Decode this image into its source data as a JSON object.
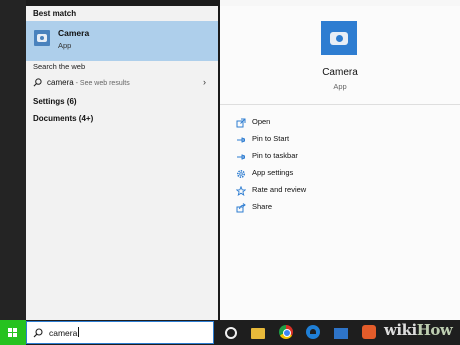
{
  "search_results": {
    "best_match_title": "Best match",
    "best_match": {
      "name": "Camera",
      "type": "App",
      "icon": "camera-icon"
    },
    "search_web_title": "Search the web",
    "web_result": {
      "query": "camera",
      "hint": " - See web results"
    },
    "settings_label": "Settings (6)",
    "documents_label": "Documents (4+)"
  },
  "detail": {
    "name": "Camera",
    "type": "App",
    "actions": [
      {
        "label": "Open",
        "icon": "open-icon"
      },
      {
        "label": "Pin to Start",
        "icon": "pin-icon"
      },
      {
        "label": "Pin to taskbar",
        "icon": "pin-icon"
      },
      {
        "label": "App settings",
        "icon": "gear-icon"
      },
      {
        "label": "Rate and review",
        "icon": "star-icon"
      },
      {
        "label": "Share",
        "icon": "share-icon"
      }
    ]
  },
  "taskbar": {
    "search_value": "camera",
    "apps": [
      "cortana-icon",
      "file-explorer-icon",
      "chrome-icon",
      "edge-icon",
      "mail-icon",
      "app-icon"
    ]
  },
  "watermark": {
    "text": "wiki",
    "accent": "How"
  },
  "colors": {
    "accent": "#2e7dd1",
    "selection": "#aecfeb",
    "start_button": "#26c21f"
  }
}
